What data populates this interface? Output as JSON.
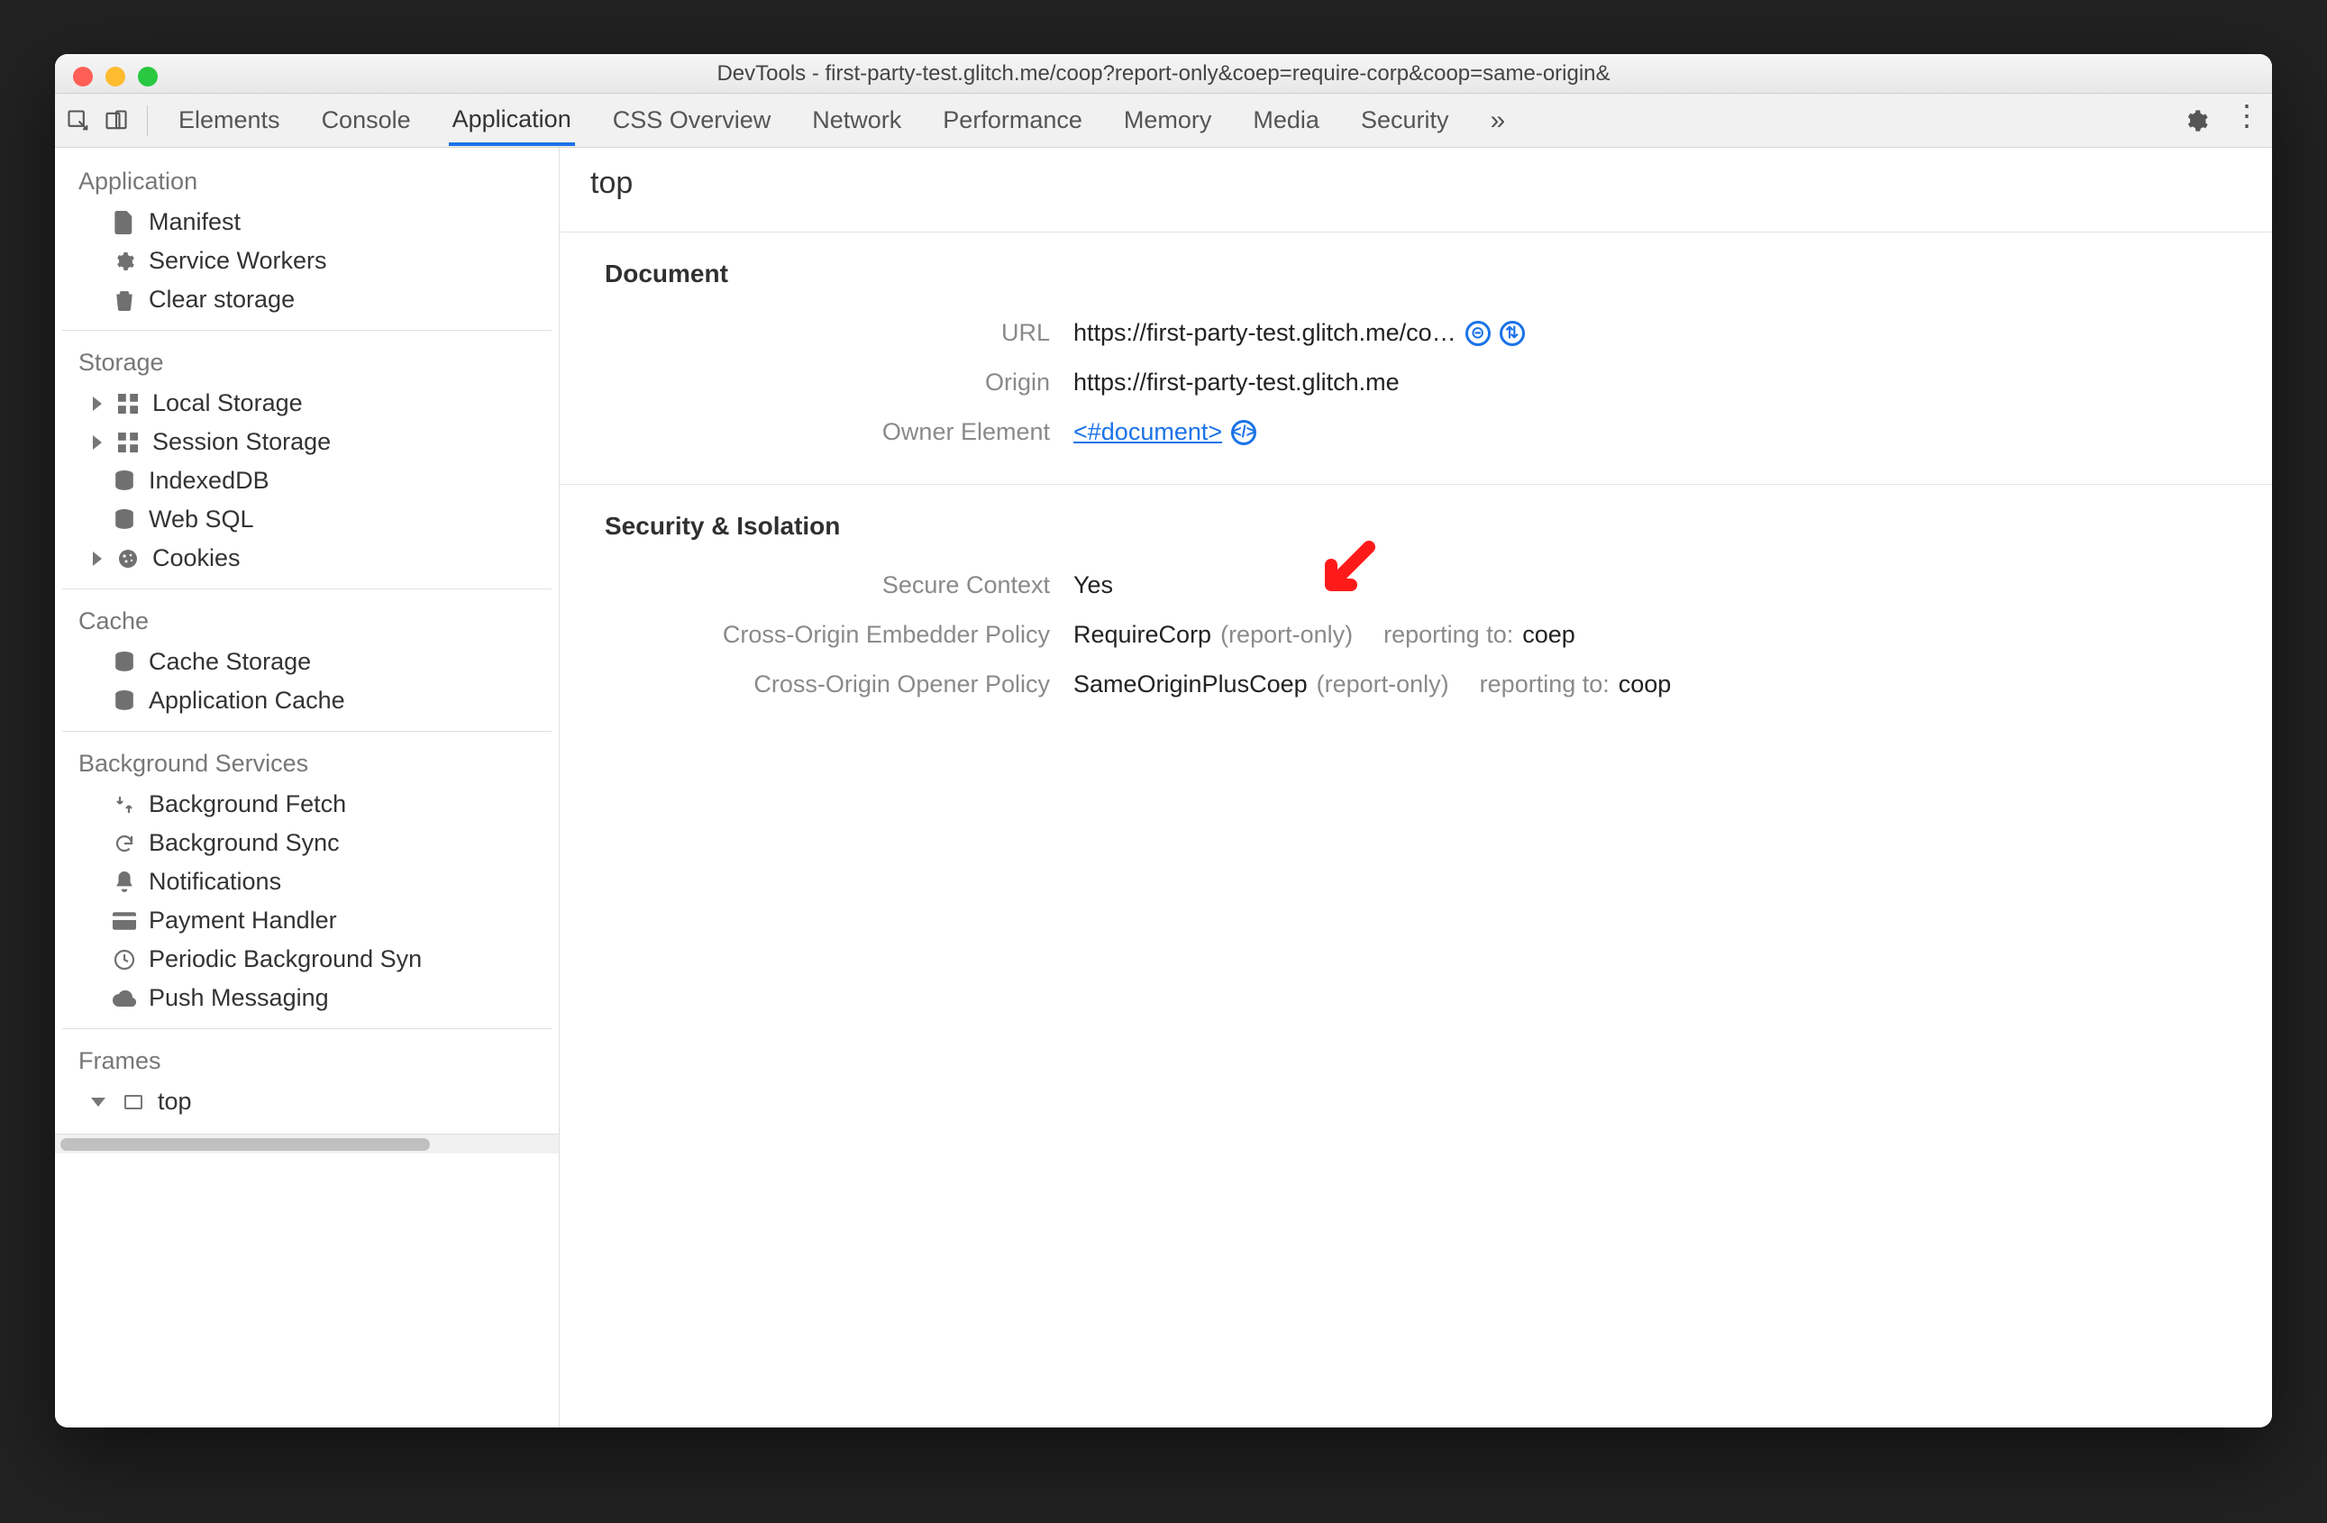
{
  "window": {
    "title": "DevTools - first-party-test.glitch.me/coop?report-only&coep=require-corp&coop=same-origin&"
  },
  "tabs": {
    "items": [
      "Elements",
      "Console",
      "Application",
      "CSS Overview",
      "Network",
      "Performance",
      "Memory",
      "Media",
      "Security"
    ],
    "active_index": 2,
    "overflow_icon": "more-tabs"
  },
  "sidebar": {
    "groups": [
      {
        "title": "Application",
        "items": [
          {
            "icon": "file-icon",
            "label": "Manifest"
          },
          {
            "icon": "gear-icon",
            "label": "Service Workers"
          },
          {
            "icon": "trash-icon",
            "label": "Clear storage"
          }
        ]
      },
      {
        "title": "Storage",
        "items": [
          {
            "icon": "grid-icon",
            "label": "Local Storage",
            "expandable": true
          },
          {
            "icon": "grid-icon",
            "label": "Session Storage",
            "expandable": true
          },
          {
            "icon": "database-icon",
            "label": "IndexedDB"
          },
          {
            "icon": "database-icon",
            "label": "Web SQL"
          },
          {
            "icon": "cookie-icon",
            "label": "Cookies",
            "expandable": true
          }
        ]
      },
      {
        "title": "Cache",
        "items": [
          {
            "icon": "database-icon",
            "label": "Cache Storage"
          },
          {
            "icon": "database-icon",
            "label": "Application Cache"
          }
        ]
      },
      {
        "title": "Background Services",
        "items": [
          {
            "icon": "fetch-icon",
            "label": "Background Fetch"
          },
          {
            "icon": "sync-icon",
            "label": "Background Sync"
          },
          {
            "icon": "bell-icon",
            "label": "Notifications"
          },
          {
            "icon": "card-icon",
            "label": "Payment Handler"
          },
          {
            "icon": "clock-icon",
            "label": "Periodic Background Syn"
          },
          {
            "icon": "cloud-icon",
            "label": "Push Messaging"
          }
        ]
      },
      {
        "title": "Frames",
        "items": [
          {
            "icon": "frame-icon",
            "label": "top",
            "expandable": true,
            "expanded": true
          }
        ]
      }
    ]
  },
  "main": {
    "heading": "top",
    "document_section": {
      "title": "Document",
      "url_label": "URL",
      "url_value": "https://first-party-test.glitch.me/co…",
      "origin_label": "Origin",
      "origin_value": "https://first-party-test.glitch.me",
      "owner_label": "Owner Element",
      "owner_value": "<#document>"
    },
    "security_section": {
      "title": "Security & Isolation",
      "secure_label": "Secure Context",
      "secure_value": "Yes",
      "coep_label": "Cross-Origin Embedder Policy",
      "coep_value": "RequireCorp",
      "coep_report_only": "(report-only)",
      "coep_reporting_label": "reporting to:",
      "coep_reporting_value": "coep",
      "coop_label": "Cross-Origin Opener Policy",
      "coop_value": "SameOriginPlusCoep",
      "coop_report_only": "(report-only)",
      "coop_reporting_label": "reporting to:",
      "coop_reporting_value": "coop"
    }
  }
}
